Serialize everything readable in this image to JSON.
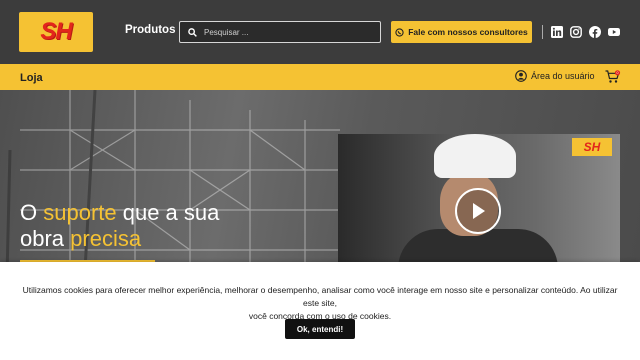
{
  "header": {
    "logo_text": "SH",
    "produtos_label": "Produtos",
    "search_placeholder": "Pesquisar ...",
    "consultores_label": "Fale com nossos consultores",
    "social": [
      "linkedin-icon",
      "instagram-icon",
      "facebook-icon",
      "youtube-icon"
    ]
  },
  "subbar": {
    "loja_label": "Loja",
    "area_label": "Área do usuário",
    "cart_count": "0"
  },
  "hero": {
    "line1_pre": "O ",
    "line1_highlight": "suporte",
    "line1_post": " que a sua",
    "line2_pre": "obra ",
    "line2_highlight": "precisa",
    "video_logo_text": "SH"
  },
  "cookie": {
    "line1": "Utilizamos cookies para oferecer melhor experiência, melhorar o desempenho, analisar como você interage em nosso site e personalizar conteúdo. Ao utilizar este site,",
    "line2": "você concorda com o uso de cookies.",
    "button_label": "Ok, entendi!"
  },
  "colors": {
    "brand_yellow": "#f5c233",
    "brand_red": "#e3261b",
    "topbar": "#3c3c3c"
  }
}
